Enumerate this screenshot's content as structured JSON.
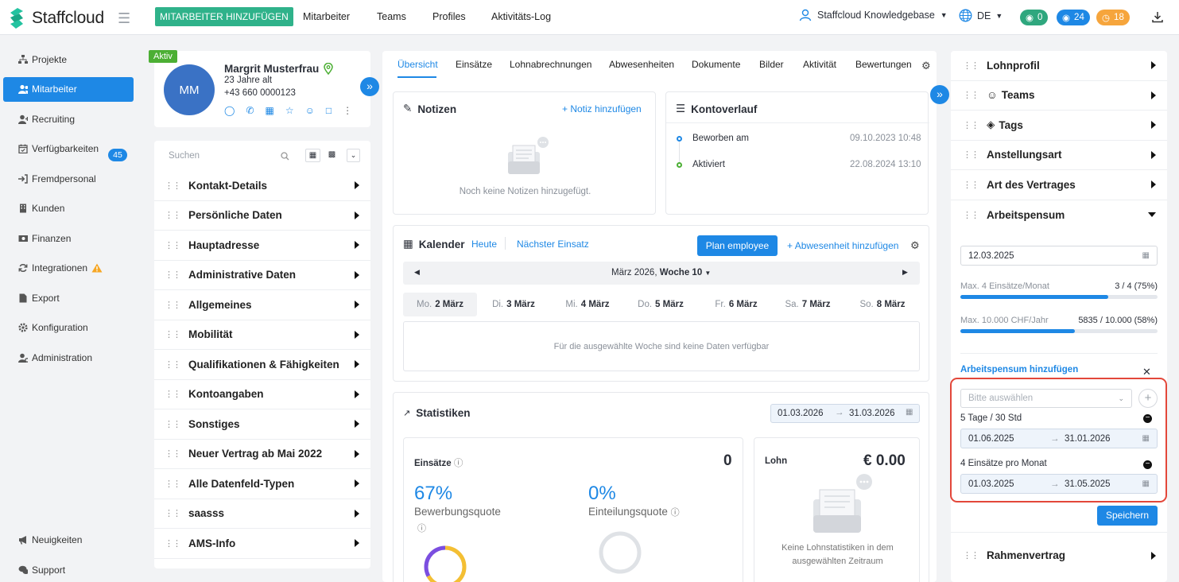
{
  "app": {
    "name": "Staffcloud",
    "add_button": "MITARBEITER HINZUFÜGEN"
  },
  "topnav": [
    "Mitarbeiter",
    "Teams",
    "Profiles",
    "Aktivitäts-Log"
  ],
  "account": {
    "name": "Staffcloud Knowledgebase",
    "lang": "DE"
  },
  "counters": {
    "messages": "0",
    "notifications": "24",
    "timers": "18",
    "colors": {
      "messages": "#2fa77e",
      "notifications": "#1e88e5",
      "timers": "#f6a53c"
    }
  },
  "sidebar": {
    "items": [
      {
        "label": "Projekte",
        "icon": "sitemap-icon"
      },
      {
        "label": "Mitarbeiter",
        "icon": "users-icon"
      },
      {
        "label": "Recruiting",
        "icon": "user-plus-icon",
        "badge": "45"
      },
      {
        "label": "Verfügbarkeiten",
        "icon": "calendar-check-icon"
      },
      {
        "label": "Fremdpersonal",
        "icon": "sign-in-icon"
      },
      {
        "label": "Kunden",
        "icon": "building-icon"
      },
      {
        "label": "Finanzen",
        "icon": "money-icon"
      },
      {
        "label": "Integrationen",
        "icon": "sync-icon"
      },
      {
        "label": "Export",
        "icon": "file-icon"
      },
      {
        "label": "Konfiguration",
        "icon": "gear-icon"
      },
      {
        "label": "Administration",
        "icon": "user-cog-icon"
      }
    ],
    "bottom": [
      {
        "label": "Neuigkeiten",
        "icon": "megaphone-icon"
      },
      {
        "label": "Support",
        "icon": "chat-icon"
      }
    ]
  },
  "profile": {
    "status": "Aktiv",
    "initials": "MM",
    "name": "Margrit Musterfrau",
    "age": "23 Jahre alt",
    "phone": "+43 660 0000123"
  },
  "search": {
    "placeholder": "Suchen"
  },
  "sections": [
    "Kontakt-Details",
    "Persönliche Daten",
    "Hauptadresse",
    "Administrative Daten",
    "Allgemeines",
    "Mobilität",
    "Qualifikationen & Fähigkeiten",
    "Kontoangaben",
    "Sonstiges",
    "Neuer Vertrag ab Mai 2022",
    "Alle Datenfeld-Typen",
    "saasss",
    "AMS-Info"
  ],
  "tabs": [
    "Übersicht",
    "Einsätze",
    "Lohnabrechnungen",
    "Abwesenheiten",
    "Dokumente",
    "Bilder",
    "Aktivität",
    "Bewertungen"
  ],
  "notes": {
    "title": "Notizen",
    "add": "Notiz hinzufügen",
    "empty": "Noch keine Notizen hinzugefügt."
  },
  "history": {
    "title": "Kontoverlauf",
    "entries": [
      {
        "label": "Beworben am",
        "date": "09.10.2023 10:48"
      },
      {
        "label": "Aktiviert",
        "date": "22.08.2024 13:10"
      }
    ]
  },
  "calendar": {
    "title": "Kalender",
    "today": "Heute",
    "next": "Nächster Einsatz",
    "plan": "Plan employee",
    "absence": "Abwesenheit hinzufügen",
    "month": "März 2026,",
    "week": "Woche 10",
    "days": [
      {
        "d": "Mo.",
        "n": "2 März"
      },
      {
        "d": "Di.",
        "n": "3 März"
      },
      {
        "d": "Mi.",
        "n": "4 März"
      },
      {
        "d": "Do.",
        "n": "5 März"
      },
      {
        "d": "Fr.",
        "n": "6 März"
      },
      {
        "d": "Sa.",
        "n": "7 März"
      },
      {
        "d": "So.",
        "n": "8 März"
      }
    ],
    "empty": "Für die ausgewählte Woche sind keine Daten verfügbar"
  },
  "stats": {
    "title": "Statistiken",
    "from": "01.03.2026",
    "to": "31.03.2026",
    "einsaetze_label": "Einsätze",
    "einsaetze_value": "0",
    "quote1_value": "67%",
    "quote1_label": "Bewerbungsquote",
    "quote2_value": "0%",
    "quote2_label": "Einteilungsquote",
    "lohn_label": "Lohn",
    "lohn_value": "€ 0.00",
    "lohn_empty": "Keine Lohnstatistiken in dem ausgewählten Zeitraum"
  },
  "right": {
    "rows_top": [
      "Lohnprofil",
      "Teams",
      "Tags",
      "Anstellungsart",
      "Art des Vertrages",
      "Arbeitspensum"
    ],
    "date": "12.03.2025",
    "limit1": {
      "label": "Max. 4 Einsätze/Monat",
      "value": "3 / 4 (75%)",
      "fraction": 0.75
    },
    "limit2": {
      "label": "Max. 10.000 CHF/Jahr",
      "value": "5835 / 10.000 (58%)",
      "fraction": 0.58
    },
    "add_link": "Arbeitspensum hinzufügen",
    "select_placeholder": "Bitte auswählen",
    "pensum1": {
      "label": "5 Tage / 30 Std",
      "from": "01.06.2025",
      "to": "31.01.2026"
    },
    "pensum2": {
      "label": "4 Einsätze pro Monat",
      "from": "01.03.2025",
      "to": "31.05.2025"
    },
    "save": "Speichern",
    "rows_bottom": [
      "Rahmenvertrag"
    ]
  }
}
